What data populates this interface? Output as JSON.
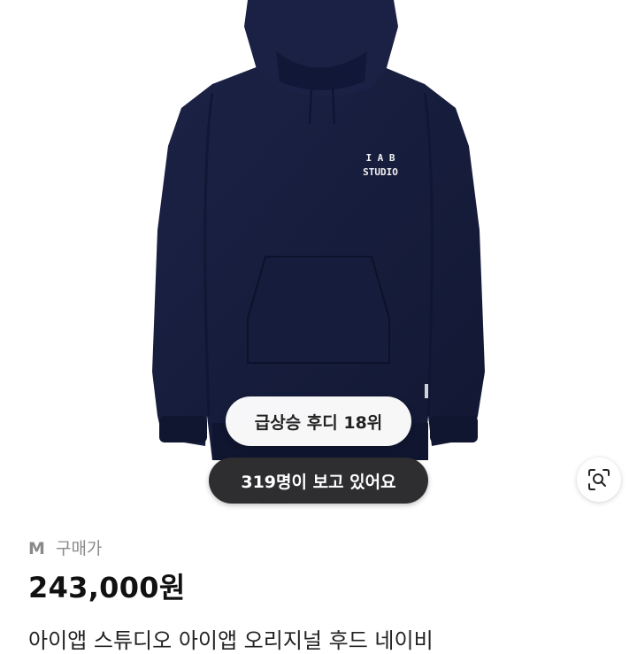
{
  "product": {
    "logo_line1": "I A B",
    "logo_line2": "STUDIO",
    "rank_badge": "급상승 후디 18위",
    "viewers_badge": "319명이 보고 있어요",
    "size": "M",
    "price_label": "구매가",
    "price": "243,000원",
    "title": "아이앱 스튜디오 아이앱 오리지널 후드 네이비"
  },
  "icons": {
    "lens": "visual-search-icon"
  },
  "colors": {
    "hoodie": "#151c3a",
    "dark_pill": "#2e2e30",
    "price_text": "#111111",
    "label_gray": "#8a8a8a"
  }
}
